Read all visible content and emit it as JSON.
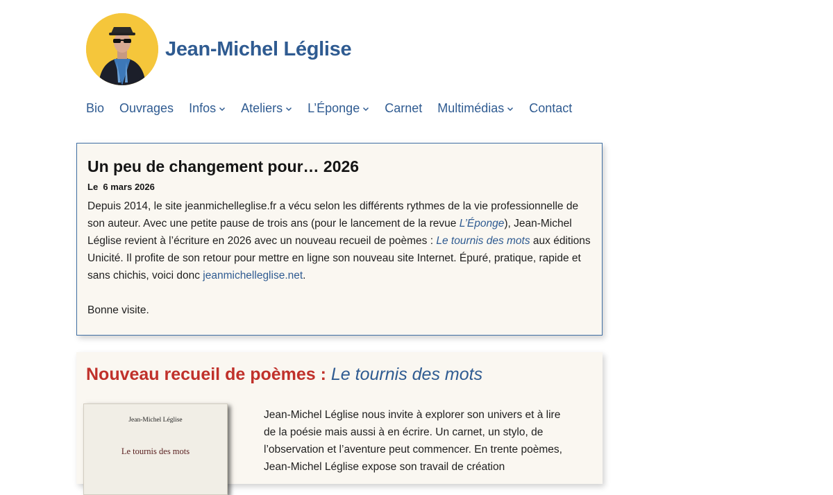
{
  "header": {
    "site_title": "Jean-Michel Léglise",
    "brand_color": "#2f5b91",
    "avatar_bg": "#f5c63b"
  },
  "nav": {
    "items": [
      {
        "label": "Bio",
        "has_dropdown": false
      },
      {
        "label": "Ouvrages",
        "has_dropdown": false
      },
      {
        "label": "Infos",
        "has_dropdown": true
      },
      {
        "label": "Ateliers",
        "has_dropdown": true
      },
      {
        "label": "L’Éponge",
        "has_dropdown": true
      },
      {
        "label": "Carnet",
        "has_dropdown": false
      },
      {
        "label": "Multimédias",
        "has_dropdown": true
      },
      {
        "label": "Contact",
        "has_dropdown": false
      }
    ]
  },
  "post": {
    "title": "Un peu de changement pour… 2026",
    "date_prefix": "Le",
    "date": "6 mars 2026",
    "p1_a": "Depuis 2014, le site jeanmichelleglise.fr a vécu selon les différents rythmes de la vie professionnelle de son auteur. Avec une petite pause de trois ans (pour le lancement de la revue ",
    "link_eponge": "L’Éponge",
    "p1_b": "), Jean-Michel Léglise revient à l’écriture en 2026 avec un nouveau recueil de poèmes : ",
    "link_tournis": "Le tournis des mots",
    "p1_c": " aux éditions Unicité. Il profite de son retour pour mettre en ligne son nouveau site Internet. Épuré, pratique, rapide et sans chichis, voici donc ",
    "link_site": "jeanmichelleglise.net",
    "p1_d": ".",
    "p2": "Bonne visite."
  },
  "promo": {
    "title_prefix": "Nouveau recueil de poèmes :",
    "title_book": "Le tournis des mots",
    "accent_color": "#c0312b",
    "book_cover": {
      "author": "Jean-Michel Léglise",
      "title": "Le tournis des mots"
    },
    "text": "Jean-Michel Léglise nous invite à explorer son univers et à lire de la poésie mais aussi à en écrire. Un carnet, un stylo, de l’observation et l’aventure peut commencer. En trente poèmes, Jean-Michel Léglise expose son travail de création"
  }
}
